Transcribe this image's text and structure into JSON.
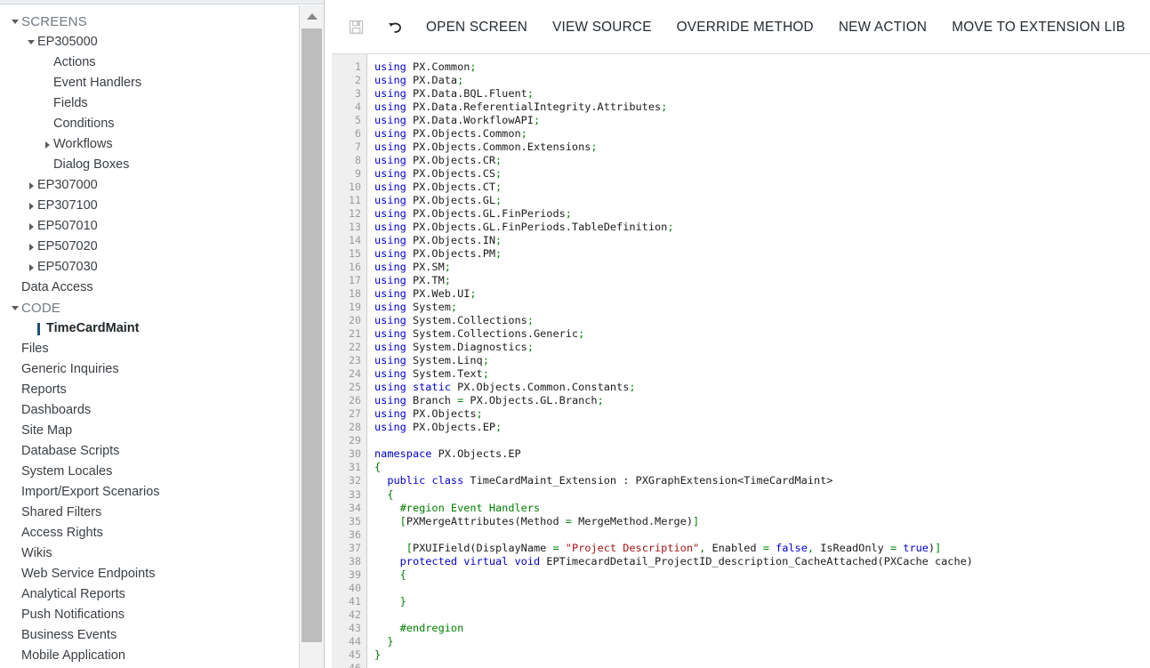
{
  "sidebar": {
    "scrollbar": {
      "up_arrow_icon": "triangle-up-icon"
    },
    "tree": [
      {
        "label": "SCREENS",
        "depth": 0,
        "twisty": "down",
        "group": true,
        "selected": false
      },
      {
        "label": "EP305000",
        "depth": 1,
        "twisty": "down",
        "group": false,
        "selected": false
      },
      {
        "label": "Actions",
        "depth": 2,
        "twisty": "none",
        "group": false,
        "selected": false
      },
      {
        "label": "Event Handlers",
        "depth": 2,
        "twisty": "none",
        "group": false,
        "selected": false
      },
      {
        "label": "Fields",
        "depth": 2,
        "twisty": "none",
        "group": false,
        "selected": false
      },
      {
        "label": "Conditions",
        "depth": 2,
        "twisty": "none",
        "group": false,
        "selected": false
      },
      {
        "label": "Workflows",
        "depth": 2,
        "twisty": "right",
        "group": false,
        "selected": false
      },
      {
        "label": "Dialog Boxes",
        "depth": 2,
        "twisty": "none",
        "group": false,
        "selected": false
      },
      {
        "label": "EP307000",
        "depth": 1,
        "twisty": "right",
        "group": false,
        "selected": false
      },
      {
        "label": "EP307100",
        "depth": 1,
        "twisty": "right",
        "group": false,
        "selected": false
      },
      {
        "label": "EP507010",
        "depth": 1,
        "twisty": "right",
        "group": false,
        "selected": false
      },
      {
        "label": "EP507020",
        "depth": 1,
        "twisty": "right",
        "group": false,
        "selected": false
      },
      {
        "label": "EP507030",
        "depth": 1,
        "twisty": "right",
        "group": false,
        "selected": false
      },
      {
        "label": "Data Access",
        "depth": 0,
        "twisty": "none",
        "group": false,
        "selected": false
      },
      {
        "label": "CODE",
        "depth": 0,
        "twisty": "down",
        "group": true,
        "selected": false
      },
      {
        "label": "TimeCardMaint",
        "depth": 1,
        "twisty": "none",
        "group": false,
        "selected": true
      },
      {
        "label": "Files",
        "depth": 0,
        "twisty": "none",
        "group": false,
        "selected": false
      },
      {
        "label": "Generic Inquiries",
        "depth": 0,
        "twisty": "none",
        "group": false,
        "selected": false
      },
      {
        "label": "Reports",
        "depth": 0,
        "twisty": "none",
        "group": false,
        "selected": false
      },
      {
        "label": "Dashboards",
        "depth": 0,
        "twisty": "none",
        "group": false,
        "selected": false
      },
      {
        "label": "Site Map",
        "depth": 0,
        "twisty": "none",
        "group": false,
        "selected": false
      },
      {
        "label": "Database Scripts",
        "depth": 0,
        "twisty": "none",
        "group": false,
        "selected": false
      },
      {
        "label": "System Locales",
        "depth": 0,
        "twisty": "none",
        "group": false,
        "selected": false
      },
      {
        "label": "Import/Export Scenarios",
        "depth": 0,
        "twisty": "none",
        "group": false,
        "selected": false
      },
      {
        "label": "Shared Filters",
        "depth": 0,
        "twisty": "none",
        "group": false,
        "selected": false
      },
      {
        "label": "Access Rights",
        "depth": 0,
        "twisty": "none",
        "group": false,
        "selected": false
      },
      {
        "label": "Wikis",
        "depth": 0,
        "twisty": "none",
        "group": false,
        "selected": false
      },
      {
        "label": "Web Service Endpoints",
        "depth": 0,
        "twisty": "none",
        "group": false,
        "selected": false
      },
      {
        "label": "Analytical Reports",
        "depth": 0,
        "twisty": "none",
        "group": false,
        "selected": false
      },
      {
        "label": "Push Notifications",
        "depth": 0,
        "twisty": "none",
        "group": false,
        "selected": false
      },
      {
        "label": "Business Events",
        "depth": 0,
        "twisty": "none",
        "group": false,
        "selected": false
      },
      {
        "label": "Mobile Application",
        "depth": 0,
        "twisty": "none",
        "group": false,
        "selected": false
      }
    ]
  },
  "toolbar": {
    "save_icon": "save-floppy-icon",
    "save_disabled": true,
    "undo_icon": "undo-arrow-icon",
    "buttons": [
      "OPEN SCREEN",
      "VIEW SOURCE",
      "OVERRIDE METHOD",
      "NEW ACTION",
      "MOVE TO EXTENSION LIB"
    ]
  },
  "editor": {
    "first_line": 1,
    "last_line": 46,
    "lines": [
      [
        [
          "k",
          "using "
        ],
        [
          "n",
          "PX.Common"
        ],
        [
          "p",
          ";"
        ]
      ],
      [
        [
          "k",
          "using "
        ],
        [
          "n",
          "PX.Data"
        ],
        [
          "p",
          ";"
        ]
      ],
      [
        [
          "k",
          "using "
        ],
        [
          "n",
          "PX.Data.BQL.Fluent"
        ],
        [
          "p",
          ";"
        ]
      ],
      [
        [
          "k",
          "using "
        ],
        [
          "n",
          "PX.Data.ReferentialIntegrity.Attributes"
        ],
        [
          "p",
          ";"
        ]
      ],
      [
        [
          "k",
          "using "
        ],
        [
          "n",
          "PX.Data.WorkflowAPI"
        ],
        [
          "p",
          ";"
        ]
      ],
      [
        [
          "k",
          "using "
        ],
        [
          "n",
          "PX.Objects.Common"
        ],
        [
          "p",
          ";"
        ]
      ],
      [
        [
          "k",
          "using "
        ],
        [
          "n",
          "PX.Objects.Common.Extensions"
        ],
        [
          "p",
          ";"
        ]
      ],
      [
        [
          "k",
          "using "
        ],
        [
          "n",
          "PX.Objects.CR"
        ],
        [
          "p",
          ";"
        ]
      ],
      [
        [
          "k",
          "using "
        ],
        [
          "n",
          "PX.Objects.CS"
        ],
        [
          "p",
          ";"
        ]
      ],
      [
        [
          "k",
          "using "
        ],
        [
          "n",
          "PX.Objects.CT"
        ],
        [
          "p",
          ";"
        ]
      ],
      [
        [
          "k",
          "using "
        ],
        [
          "n",
          "PX.Objects.GL"
        ],
        [
          "p",
          ";"
        ]
      ],
      [
        [
          "k",
          "using "
        ],
        [
          "n",
          "PX.Objects.GL.FinPeriods"
        ],
        [
          "p",
          ";"
        ]
      ],
      [
        [
          "k",
          "using "
        ],
        [
          "n",
          "PX.Objects.GL.FinPeriods.TableDefinition"
        ],
        [
          "p",
          ";"
        ]
      ],
      [
        [
          "k",
          "using "
        ],
        [
          "n",
          "PX.Objects.IN"
        ],
        [
          "p",
          ";"
        ]
      ],
      [
        [
          "k",
          "using "
        ],
        [
          "n",
          "PX.Objects.PM"
        ],
        [
          "p",
          ";"
        ]
      ],
      [
        [
          "k",
          "using "
        ],
        [
          "n",
          "PX.SM"
        ],
        [
          "p",
          ";"
        ]
      ],
      [
        [
          "k",
          "using "
        ],
        [
          "n",
          "PX.TM"
        ],
        [
          "p",
          ";"
        ]
      ],
      [
        [
          "k",
          "using "
        ],
        [
          "n",
          "PX.Web.UI"
        ],
        [
          "p",
          ";"
        ]
      ],
      [
        [
          "k",
          "using "
        ],
        [
          "n",
          "System"
        ],
        [
          "p",
          ";"
        ]
      ],
      [
        [
          "k",
          "using "
        ],
        [
          "n",
          "System.Collections"
        ],
        [
          "p",
          ";"
        ]
      ],
      [
        [
          "k",
          "using "
        ],
        [
          "n",
          "System.Collections.Generic"
        ],
        [
          "p",
          ";"
        ]
      ],
      [
        [
          "k",
          "using "
        ],
        [
          "n",
          "System.Diagnostics"
        ],
        [
          "p",
          ";"
        ]
      ],
      [
        [
          "k",
          "using "
        ],
        [
          "n",
          "System.Linq"
        ],
        [
          "p",
          ";"
        ]
      ],
      [
        [
          "k",
          "using "
        ],
        [
          "n",
          "System.Text"
        ],
        [
          "p",
          ";"
        ]
      ],
      [
        [
          "k",
          "using static "
        ],
        [
          "n",
          "PX.Objects.Common.Constants"
        ],
        [
          "p",
          ";"
        ]
      ],
      [
        [
          "k",
          "using "
        ],
        [
          "n",
          "Branch "
        ],
        [
          "p",
          "= "
        ],
        [
          "n",
          "PX.Objects.GL.Branch"
        ],
        [
          "p",
          ";"
        ]
      ],
      [
        [
          "k",
          "using "
        ],
        [
          "n",
          "PX.Objects"
        ],
        [
          "p",
          ";"
        ]
      ],
      [
        [
          "k",
          "using "
        ],
        [
          "n",
          "PX.Objects.EP"
        ],
        [
          "p",
          ";"
        ]
      ],
      [],
      [
        [
          "k",
          "namespace "
        ],
        [
          "n",
          "PX.Objects.EP"
        ]
      ],
      [
        [
          "p",
          "{"
        ]
      ],
      [
        [
          "n",
          "  "
        ],
        [
          "k",
          "public class "
        ],
        [
          "n",
          "TimeCardMaint_Extension : PXGraphExtension<TimeCardMaint>"
        ]
      ],
      [
        [
          "n",
          "  "
        ],
        [
          "p",
          "{"
        ]
      ],
      [
        [
          "n",
          "    "
        ],
        [
          "p",
          "#region Event Handlers"
        ]
      ],
      [
        [
          "n",
          "    "
        ],
        [
          "p",
          "["
        ],
        [
          "n",
          "PXMergeAttributes(Method "
        ],
        [
          "p",
          "= "
        ],
        [
          "n",
          "MergeMethod.Merge)"
        ],
        [
          "p",
          "]"
        ]
      ],
      [],
      [
        [
          "n",
          "     "
        ],
        [
          "p",
          "["
        ],
        [
          "n",
          "PXUIField(DisplayName "
        ],
        [
          "p",
          "= "
        ],
        [
          "s",
          "\"Project Description\""
        ],
        [
          "p",
          ", "
        ],
        [
          "n",
          "Enabled "
        ],
        [
          "p",
          "= "
        ],
        [
          "k",
          "false"
        ],
        [
          "p",
          ", "
        ],
        [
          "n",
          "IsReadOnly "
        ],
        [
          "p",
          "= "
        ],
        [
          "k",
          "true"
        ],
        [
          "n",
          ")"
        ],
        [
          "p",
          "]"
        ]
      ],
      [
        [
          "n",
          "    "
        ],
        [
          "k",
          "protected virtual void "
        ],
        [
          "n",
          "EPTimecardDetail_ProjectID_description_CacheAttached(PXCache cache)"
        ]
      ],
      [
        [
          "n",
          "    "
        ],
        [
          "p",
          "{"
        ]
      ],
      [],
      [
        [
          "n",
          "    "
        ],
        [
          "p",
          "}"
        ]
      ],
      [],
      [
        [
          "n",
          "    "
        ],
        [
          "p",
          "#endregion"
        ]
      ],
      [
        [
          "n",
          "  "
        ],
        [
          "p",
          "}"
        ]
      ],
      [
        [
          "p",
          "}"
        ]
      ],
      []
    ]
  },
  "colors": {
    "keyword": "#0000cd",
    "punctuation": "#008000",
    "string": "#a31515",
    "plain": "#1b1b1b",
    "selection_marker": "#1a5276"
  }
}
